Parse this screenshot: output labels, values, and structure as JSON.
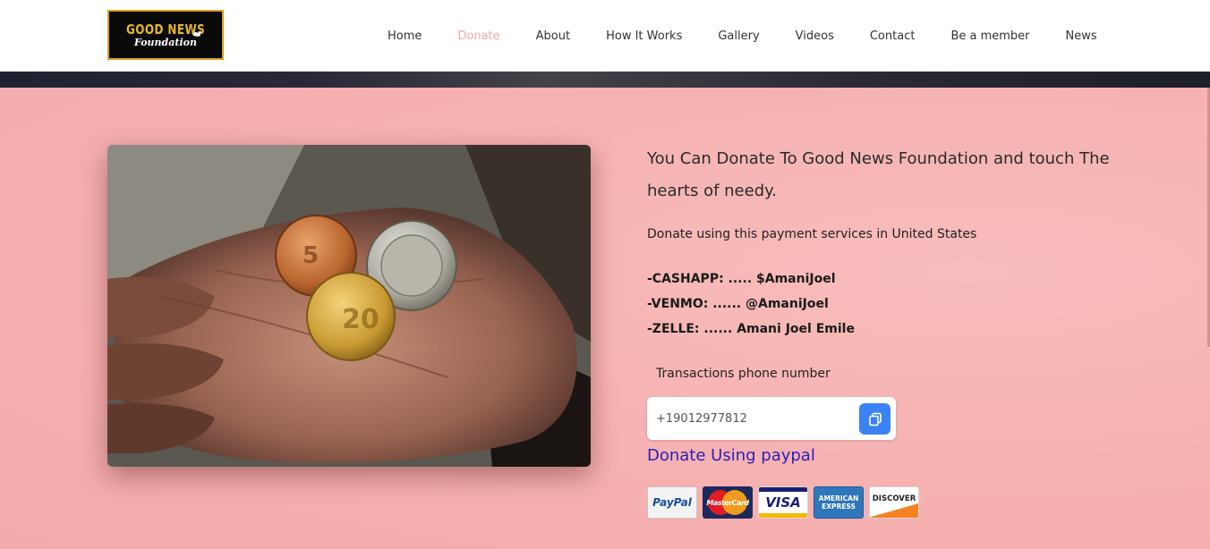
{
  "header": {
    "logo": {
      "line1": "GOOD NEWS",
      "line2": "Foundation"
    },
    "nav": [
      {
        "label": "Home",
        "active": false
      },
      {
        "label": "Donate",
        "active": true
      },
      {
        "label": "About",
        "active": false
      },
      {
        "label": "How It Works",
        "active": false
      },
      {
        "label": "Gallery",
        "active": false
      },
      {
        "label": "Videos",
        "active": false
      },
      {
        "label": "Contact",
        "active": false
      },
      {
        "label": "Be a member",
        "active": false
      },
      {
        "label": "News",
        "active": false
      }
    ]
  },
  "donate": {
    "intro": "You Can Donate To Good News Foundation and touch The hearts of needy.",
    "subintro": "Donate using this payment services in United States",
    "methods": [
      "-CASHAPP: ..... $AmaniJoel",
      "-VENMO: ...... @AmaniJoel",
      "-ZELLE: ...... Amani Joel Emile"
    ],
    "phone_label": "Transactions phone number",
    "phone_value": "+19012977812",
    "paypal_link": "Donate Using paypal",
    "cards": {
      "paypal": "PayPal",
      "mastercard": "MasterCard",
      "visa": "VISA",
      "amex_line1": "AMERICAN",
      "amex_line2": "EXPRESS",
      "discover": "DISCOVER"
    }
  },
  "colors": {
    "accent_pink": "#f4a6a6",
    "section_bg": "#f6b4b4",
    "copy_button": "#3b82f6",
    "link": "#2d1fb5",
    "logo_gold": "#e8b62a"
  },
  "icons": {
    "copy": "copy-icon",
    "dove": "dove-icon"
  }
}
